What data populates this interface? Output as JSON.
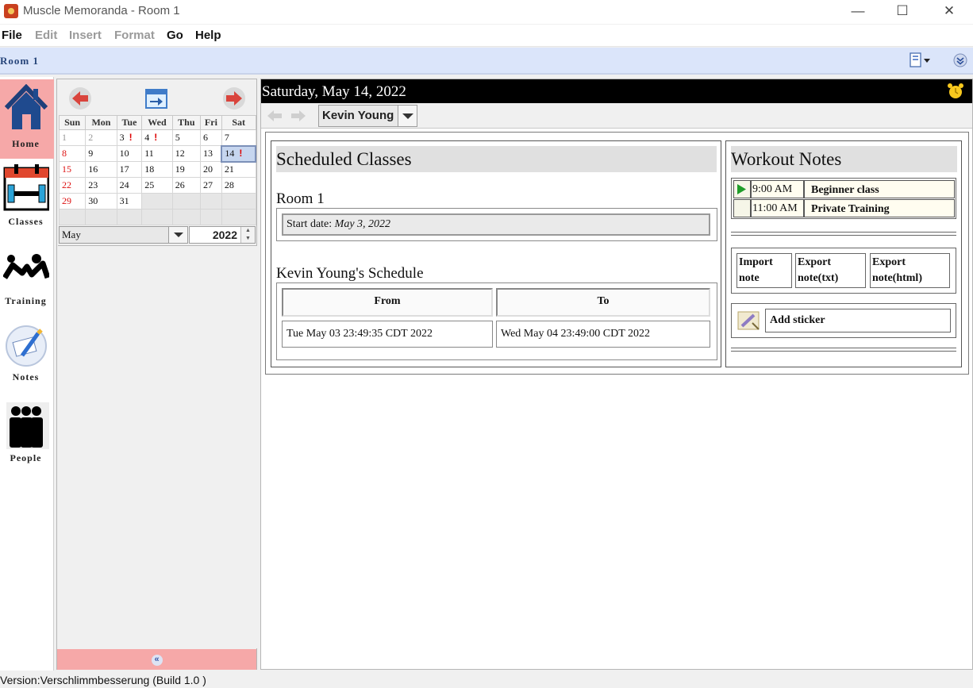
{
  "window": {
    "title": "Muscle Memoranda - Room 1",
    "controls": {
      "minimize": "—",
      "maximize": "☐",
      "close": "✕"
    }
  },
  "menu": {
    "items": [
      {
        "label": "File",
        "enabled": true
      },
      {
        "label": "Edit",
        "enabled": false
      },
      {
        "label": "Insert",
        "enabled": false
      },
      {
        "label": "Format",
        "enabled": false
      },
      {
        "label": "Go",
        "enabled": true
      },
      {
        "label": "Help",
        "enabled": true
      }
    ]
  },
  "roombar": {
    "room": "Room 1"
  },
  "leftnav": {
    "items": [
      {
        "label": "Home",
        "icon": "house-icon",
        "active": true
      },
      {
        "label": "Classes",
        "icon": "calendar-dumbbell-icon",
        "active": false
      },
      {
        "label": "Training",
        "icon": "training-icon",
        "active": false
      },
      {
        "label": "Notes",
        "icon": "notes-icon",
        "active": false
      },
      {
        "label": "People",
        "icon": "people-icon",
        "active": false
      }
    ]
  },
  "calendar": {
    "weekdays": [
      "Sun",
      "Mon",
      "Tue",
      "Wed",
      "Thu",
      "Fri",
      "Sat"
    ],
    "weeks": [
      [
        {
          "d": "1",
          "kind": "outside"
        },
        {
          "d": "2",
          "kind": "outside"
        },
        {
          "d": "3",
          "mark": "!"
        },
        {
          "d": "4",
          "mark": "!"
        },
        {
          "d": "5"
        },
        {
          "d": "6"
        },
        {
          "d": "7"
        }
      ],
      [
        {
          "d": "8",
          "kind": "sun"
        },
        {
          "d": "9"
        },
        {
          "d": "10"
        },
        {
          "d": "11"
        },
        {
          "d": "12"
        },
        {
          "d": "13"
        },
        {
          "d": "14",
          "kind": "today",
          "mark": "!"
        }
      ],
      [
        {
          "d": "15",
          "kind": "sun"
        },
        {
          "d": "16"
        },
        {
          "d": "17"
        },
        {
          "d": "18"
        },
        {
          "d": "19"
        },
        {
          "d": "20"
        },
        {
          "d": "21"
        }
      ],
      [
        {
          "d": "22",
          "kind": "sun"
        },
        {
          "d": "23"
        },
        {
          "d": "24"
        },
        {
          "d": "25"
        },
        {
          "d": "26"
        },
        {
          "d": "27"
        },
        {
          "d": "28"
        }
      ],
      [
        {
          "d": "29",
          "kind": "sun"
        },
        {
          "d": "30"
        },
        {
          "d": "31"
        },
        {
          "d": "",
          "kind": "empty"
        },
        {
          "d": "",
          "kind": "empty"
        },
        {
          "d": "",
          "kind": "empty"
        },
        {
          "d": "",
          "kind": "empty"
        }
      ],
      [
        {
          "d": "",
          "kind": "empty"
        },
        {
          "d": "",
          "kind": "empty"
        },
        {
          "d": "",
          "kind": "empty"
        },
        {
          "d": "",
          "kind": "empty"
        },
        {
          "d": "",
          "kind": "empty"
        },
        {
          "d": "",
          "kind": "empty"
        },
        {
          "d": "",
          "kind": "empty"
        }
      ]
    ],
    "month": "May",
    "year": "2022",
    "collapse_label": "«"
  },
  "main": {
    "date": "Saturday, May 14, 2022",
    "user": "Kevin Young",
    "scheduled": {
      "title": "Scheduled Classes",
      "room": "Room 1",
      "start_label": "Start date:",
      "start_value": "May 3, 2022",
      "schedule_heading": "Kevin Young's Schedule",
      "col_from": "From",
      "col_to": "To",
      "from_value": "Tue May 03 23:49:35 CDT 2022",
      "to_value": "Wed May 04 23:49:00 CDT 2022"
    },
    "notes": {
      "title": "Workout Notes",
      "items": [
        {
          "time": "9:00 AM",
          "title": "Beginner class",
          "active": true
        },
        {
          "time": "11:00 AM",
          "title": "Private Training",
          "active": false
        }
      ],
      "import_line1": "Import",
      "import_line2": "note",
      "export_txt_line1": "Export",
      "export_txt_line2": "note(txt)",
      "export_html_line1": "Export",
      "export_html_line2": "note(html)",
      "sticker": "Add sticker"
    }
  },
  "status": {
    "text": "Version:Verschlimmbesserung (Build 1.0 )"
  },
  "colors": {
    "nav_active": "#f6a8a8",
    "roombar": "#dbe5fa",
    "datebar": "#000000",
    "sunday": "#dd1111"
  }
}
